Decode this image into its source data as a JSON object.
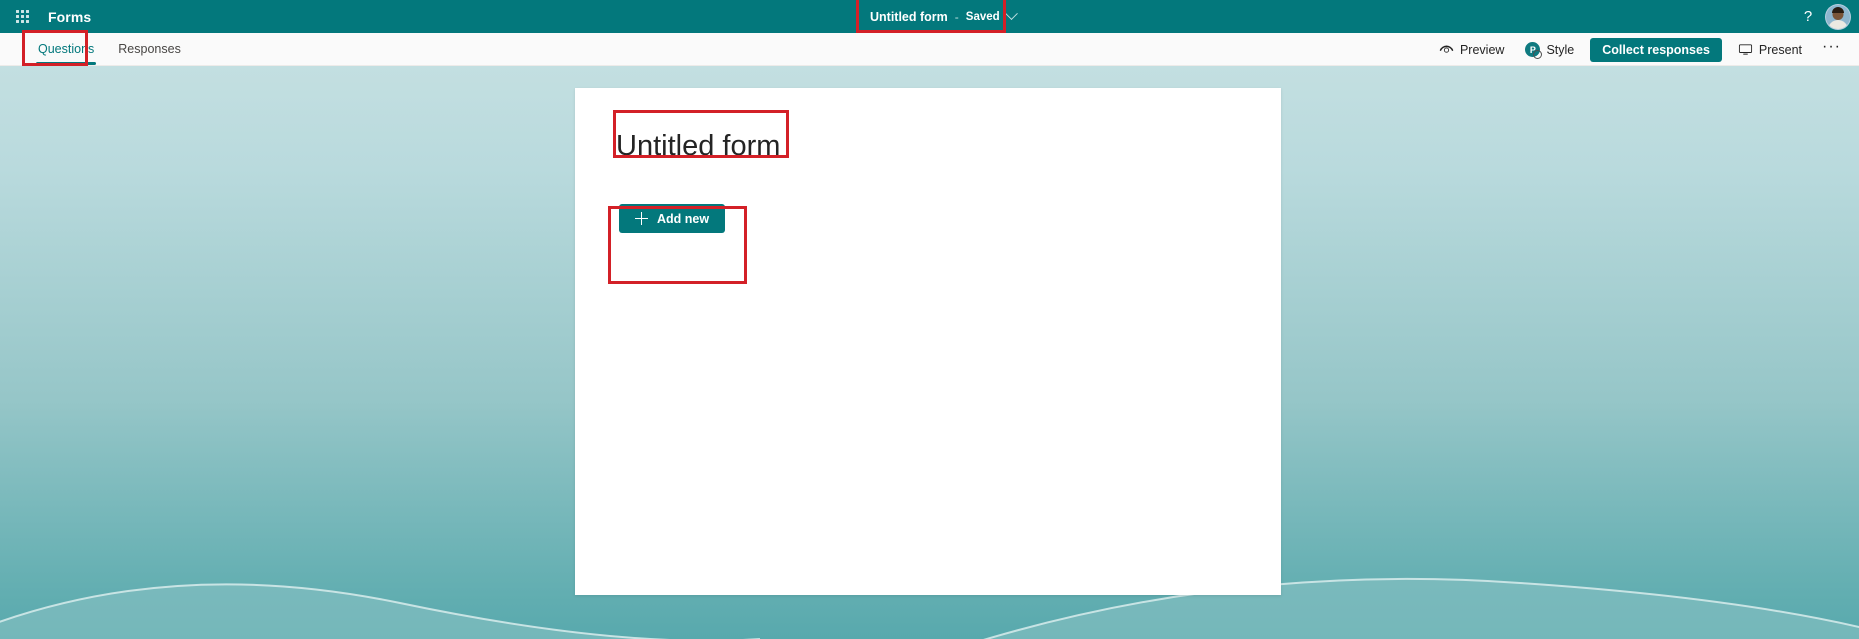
{
  "topbar": {
    "app_launcher_icon": "waffle-grid-icon",
    "brand": "Forms",
    "doc_title": "Untitled form",
    "separator": "-",
    "save_state": "Saved",
    "chevron_icon": "chevron-down-icon",
    "help_label": "?",
    "help_icon": "question-mark-icon",
    "avatar_icon": "user-avatar",
    "bar_color": "#03787c"
  },
  "commandbar": {
    "tabs": [
      {
        "label": "Questions",
        "active": true
      },
      {
        "label": "Responses",
        "active": false
      }
    ],
    "preview": {
      "label": "Preview",
      "icon": "eye-icon"
    },
    "style": {
      "label": "Style",
      "icon": "palette-icon"
    },
    "collect_responses": {
      "label": "Collect responses"
    },
    "present": {
      "label": "Present",
      "icon": "monitor-icon"
    },
    "overflow": {
      "label": "···",
      "icon": "ellipsis-icon"
    },
    "accent_color": "#03787c"
  },
  "form": {
    "title": "Untitled form",
    "add_new_label": "Add new",
    "add_new_icon": "plus-icon",
    "card_bg": "#ffffff"
  },
  "canvas": {
    "gradient_top": "#c3dfe1",
    "gradient_bottom": "#58a9ad",
    "wave_stroke": "#d8ecec"
  },
  "annotations": {
    "color": "#d32027",
    "boxes": [
      {
        "name": "doc-title-highlight",
        "target": "Untitled form - Saved"
      },
      {
        "name": "questions-tab-highlight",
        "target": "Questions"
      },
      {
        "name": "form-title-highlight",
        "target": "Untitled form"
      },
      {
        "name": "add-new-highlight",
        "target": "Add new"
      }
    ]
  }
}
